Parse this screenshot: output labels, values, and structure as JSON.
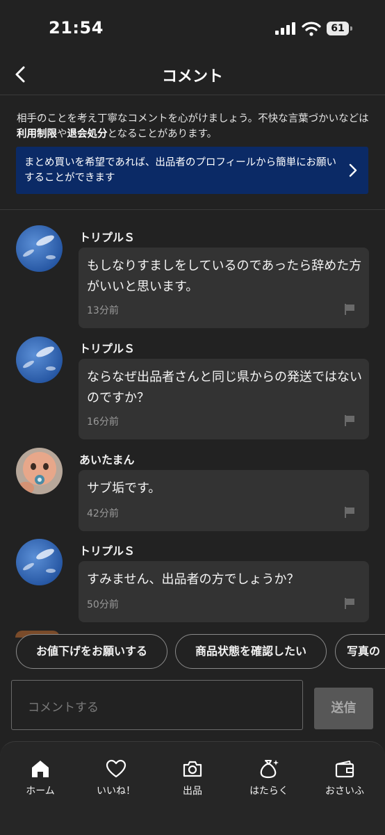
{
  "status_bar": {
    "time": "21:54",
    "battery": "61"
  },
  "nav": {
    "title": "コメント"
  },
  "notice": {
    "part1": "相手のことを考え丁寧なコメントを心がけましょう。不快な言葉づかいなどは",
    "bold1": "利用制限",
    "part2": "や",
    "bold2": "退会処分",
    "part3": "となることがあります。"
  },
  "banner": {
    "text": "まとめ買いを希望であれば、出品者のプロフィールから簡単にお願いすることができます"
  },
  "comments": [
    {
      "name": "トリプルＳ",
      "text": "もしなりすましをしているのであったら辞めた方がいいと思います。",
      "time": "13分前",
      "avatar": "sky-avatar"
    },
    {
      "name": "トリプルＳ",
      "text": "ならなぜ出品者さんと同じ県からの発送ではないのですか？",
      "time": "16分前",
      "avatar": "sky-avatar"
    },
    {
      "name": "あいたまん",
      "text": "サブ垢です。",
      "time": "42分前",
      "avatar": "baby-avatar"
    },
    {
      "name": "トリプルＳ",
      "text": "すみません、出品者の方でしょうか？",
      "time": "50分前",
      "avatar": "sky-avatar"
    }
  ],
  "chips": [
    "お値下げをお願いする",
    "商品状態を確認したい",
    "写真の"
  ],
  "comment_input": {
    "placeholder": "コメントする"
  },
  "send_button": "送信",
  "tabs": [
    {
      "label": "ホーム",
      "icon": "home-icon"
    },
    {
      "label": "いいね！",
      "icon": "heart-icon"
    },
    {
      "label": "出品",
      "icon": "camera-icon"
    },
    {
      "label": "はたらく",
      "icon": "money-bag-icon"
    },
    {
      "label": "おさいふ",
      "icon": "wallet-icon"
    }
  ],
  "colors": {
    "background": "#222222",
    "banner": "#0b2a66",
    "bubble": "#333333"
  }
}
